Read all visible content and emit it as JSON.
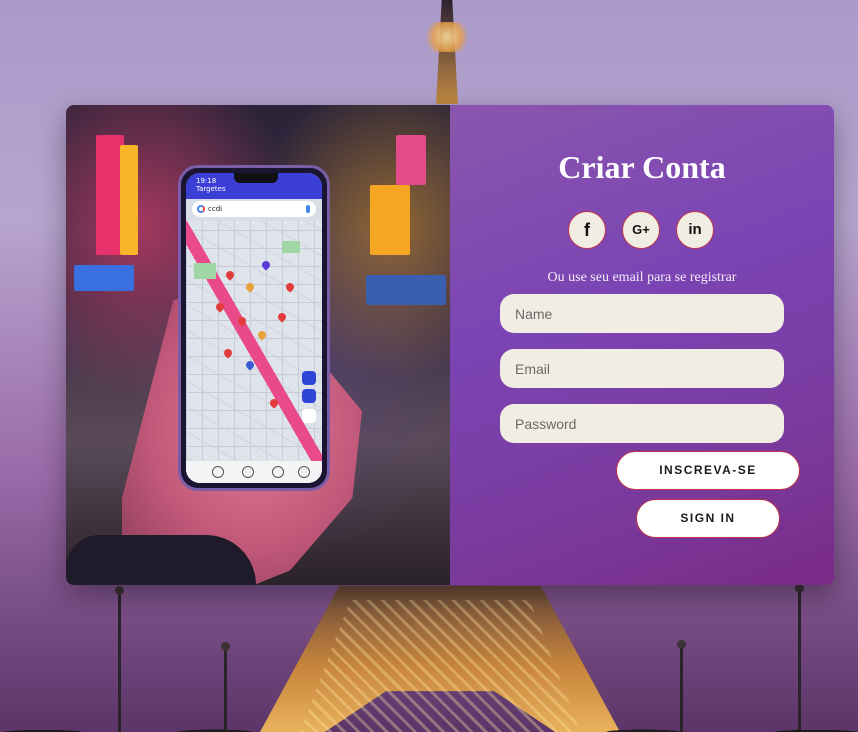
{
  "background": {
    "description_color": "#a99ac9"
  },
  "photo_panel": {
    "phone": {
      "status_text": "19:18 Targetes",
      "search_text": "ccdi",
      "icons": [
        "google-icon",
        "mic-icon",
        "location-button-icon",
        "layers-button-icon",
        "zoom-button-icon"
      ]
    }
  },
  "form": {
    "title": "Criar Conta",
    "social": [
      {
        "name": "facebook",
        "label": "f",
        "icon": "facebook-icon"
      },
      {
        "name": "google-plus",
        "label": "G+",
        "icon": "google-plus-icon"
      },
      {
        "name": "linkedin",
        "label": "in",
        "icon": "linkedin-icon"
      }
    ],
    "hint": "Ou use seu email para se registrar",
    "name_placeholder": "Name",
    "email_placeholder": "Email",
    "password_placeholder": "Password",
    "signup_label": "INSCREVA-SE",
    "signin_label": "SIGN IN"
  },
  "colors": {
    "panel_gradient_start": "#8a56ad",
    "panel_gradient_end": "#7a2a86",
    "input_bg": "#f2ede3",
    "button_border": "#c0344b",
    "button_bg": "#ffffff"
  }
}
